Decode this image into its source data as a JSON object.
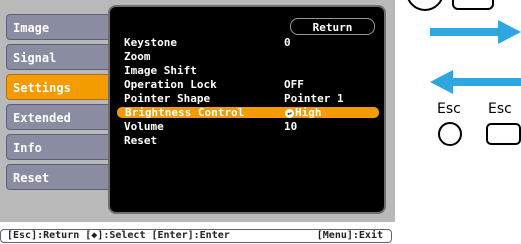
{
  "sidebar": {
    "items": [
      {
        "label": "Image"
      },
      {
        "label": "Signal"
      },
      {
        "label": "Settings",
        "active": true
      },
      {
        "label": "Extended"
      },
      {
        "label": "Info"
      },
      {
        "label": "Reset"
      }
    ]
  },
  "submenu": {
    "return_label": "Return",
    "items": [
      {
        "label": "Keystone",
        "value": "0"
      },
      {
        "label": "Zoom",
        "value": ""
      },
      {
        "label": "Image Shift",
        "value": ""
      },
      {
        "label": "Operation Lock",
        "value": "OFF"
      },
      {
        "label": "Pointer Shape",
        "value": "Pointer 1"
      },
      {
        "label": "Brightness Control",
        "value": "High",
        "selected": true
      },
      {
        "label": "Volume",
        "value": "10"
      },
      {
        "label": "Reset",
        "value": ""
      }
    ]
  },
  "footer": {
    "hint_left": "[Esc]:Return [◆]:Select [Enter]:Enter",
    "hint_right": "[Menu]:Exit"
  },
  "remote": {
    "esc_label_1": "Esc",
    "esc_label_2": "Esc"
  },
  "colors": {
    "accent": "#f39b00",
    "tab": "#8a8da1",
    "arrow": "#2fa6e0"
  }
}
